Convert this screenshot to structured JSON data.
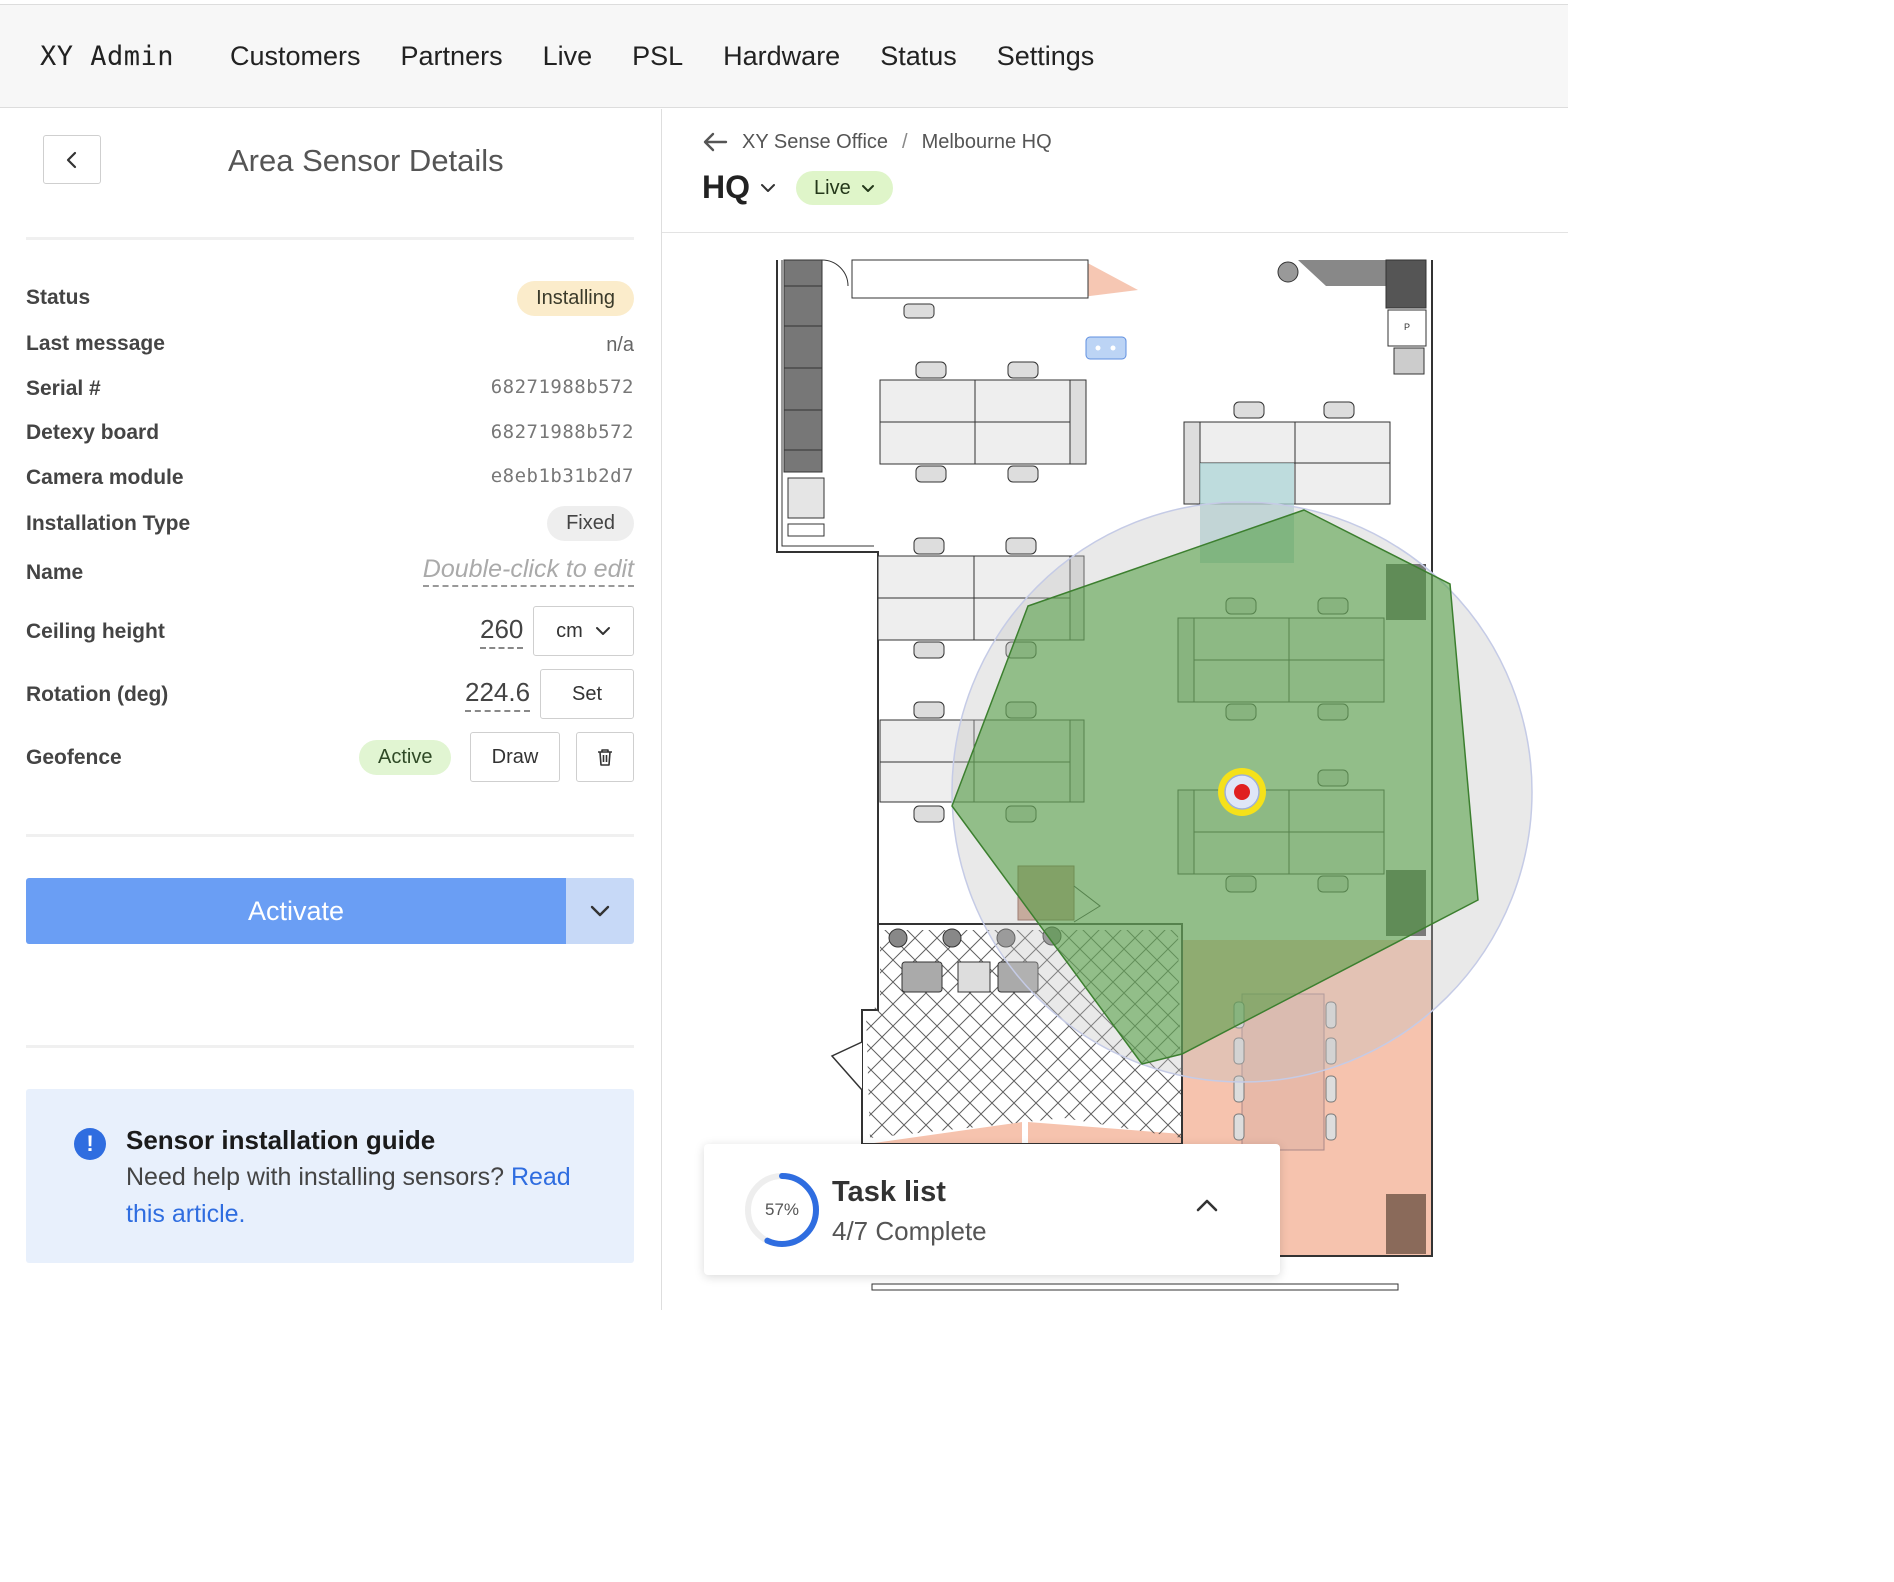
{
  "app": {
    "brand": "XY Admin"
  },
  "nav": [
    "Customers",
    "Partners",
    "Live",
    "PSL",
    "Hardware",
    "Status",
    "Settings"
  ],
  "panel": {
    "title": "Area Sensor Details",
    "rows": {
      "status_label": "Status",
      "status_value": "Installing",
      "last_message_label": "Last message",
      "last_message_value": "n/a",
      "serial_label": "Serial #",
      "serial_value": "68271988b572",
      "detexy_label": "Detexy board",
      "detexy_value": "68271988b572",
      "camera_label": "Camera module",
      "camera_value": "e8eb1b31b2d7",
      "install_type_label": "Installation Type",
      "install_type_value": "Fixed",
      "name_label": "Name",
      "name_placeholder": "Double-click to edit",
      "ceiling_label": "Ceiling height",
      "ceiling_value": "260",
      "ceiling_unit": "cm",
      "rotation_label": "Rotation (deg)",
      "rotation_value": "224.6",
      "rotation_button": "Set",
      "geofence_label": "Geofence",
      "geofence_status": "Active",
      "geofence_draw": "Draw"
    },
    "activate_label": "Activate",
    "guide": {
      "title": "Sensor installation guide",
      "body": "Need help with installing sensors? ",
      "link": "Read this article."
    }
  },
  "floor": {
    "breadcrumb": [
      "XY Sense Office",
      "Melbourne HQ"
    ],
    "name": "HQ",
    "status": "Live"
  },
  "task_list": {
    "percent_label": "57%",
    "progress": 0.57,
    "title": "Task list",
    "subtitle": "4/7 Complete"
  },
  "colors": {
    "accent": "#6a9ef4",
    "geofence_fill": "#4a9a3a",
    "sensor_dot": "#e02020",
    "sensor_ring": "#f5e11a"
  },
  "icons": [
    "chevron-left-icon",
    "chevron-down-icon",
    "trash-icon",
    "info-icon",
    "arrow-left-icon",
    "chevron-up-icon"
  ]
}
